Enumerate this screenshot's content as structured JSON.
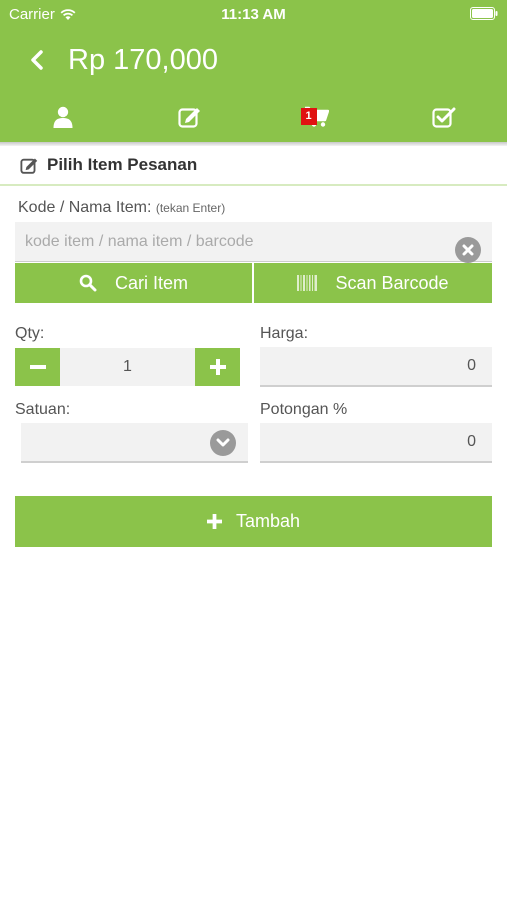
{
  "status_bar": {
    "carrier": "Carrier",
    "time": "11:13 AM"
  },
  "header": {
    "title": "Rp 170,000",
    "cart_badge": "1"
  },
  "tabs": [
    {
      "icon": "user-icon"
    },
    {
      "icon": "edit-icon"
    },
    {
      "icon": "cart-icon"
    },
    {
      "icon": "checkbox-icon"
    }
  ],
  "section": {
    "title": "Pilih Item Pesanan"
  },
  "item_code": {
    "label": "Kode / Nama Item:",
    "hint": "(tekan Enter)",
    "placeholder": "kode item / nama item / barcode",
    "value": ""
  },
  "buttons": {
    "search": "Cari Item",
    "scan": "Scan Barcode",
    "add": "Tambah"
  },
  "qty": {
    "label": "Qty:",
    "value": "1"
  },
  "price": {
    "label": "Harga:",
    "value": "0"
  },
  "unit": {
    "label": "Satuan:",
    "selected": ""
  },
  "discount": {
    "label": "Potongan %",
    "value": "0"
  },
  "colors": {
    "accent": "#8bc34a",
    "badge": "#e01212"
  }
}
